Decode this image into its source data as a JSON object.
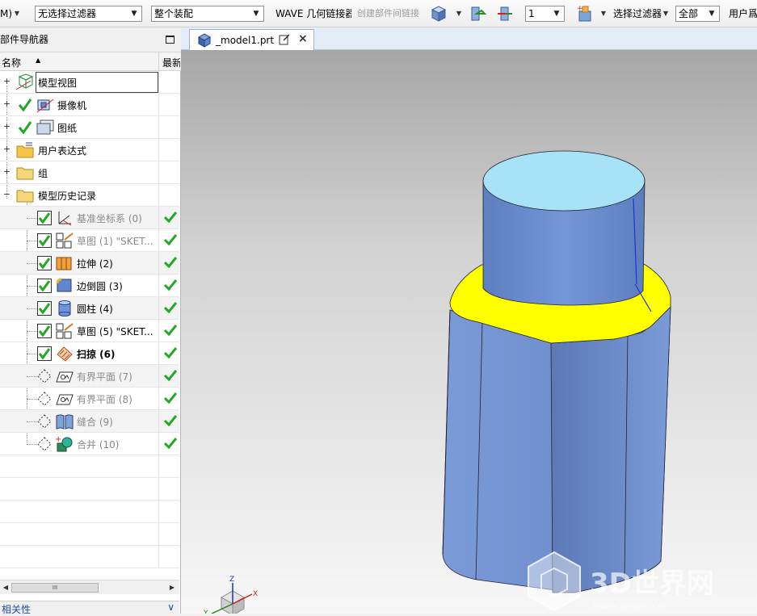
{
  "toolbar": {
    "menu_fragment": "M)",
    "type_filter": "无选择过滤器",
    "assembly_filter": "整个装配",
    "wave_label": "WAVE 几何链接器",
    "interpart_link": "创建部件间链接",
    "layer_value": "1",
    "select_filter": "选择过滤器",
    "scope_value": "全部",
    "user_fragment": "用户爲"
  },
  "navigator": {
    "title": "部件导航器",
    "col_name": "名称",
    "col_latest": "最新",
    "rows": [
      {
        "label": "模型视图"
      },
      {
        "label": "摄像机"
      },
      {
        "label": "图纸"
      },
      {
        "label": "用户表达式"
      },
      {
        "label": "组"
      },
      {
        "label": "模型历史记录"
      },
      {
        "label": "基准坐标系 (0)"
      },
      {
        "label": "草图 (1) \"SKET..."
      },
      {
        "label": "拉伸 (2)"
      },
      {
        "label": "边倒圆 (3)"
      },
      {
        "label": "圆柱 (4)"
      },
      {
        "label": "草图 (5) \"SKET..."
      },
      {
        "label": "扫掠 (6)"
      },
      {
        "label": "有界平面 (7)"
      },
      {
        "label": "有界平面 (8)"
      },
      {
        "label": "缝合 (9)"
      },
      {
        "label": "合并 (10)"
      }
    ],
    "scroll_thumb": "III",
    "dependencies": "相关性"
  },
  "graphics": {
    "tab_label": "_model1.prt",
    "watermark_text": "3D世界网",
    "watermark_url": "WWW.3DSJW.COM",
    "triad": {
      "x": "X",
      "y": "Y",
      "z": "Z"
    }
  },
  "colors": {
    "body_blue": "#6e8fcf",
    "blend_yellow": "#ffff00",
    "cap_cyan": "#a8e2f6",
    "check_green": "#22a822"
  }
}
